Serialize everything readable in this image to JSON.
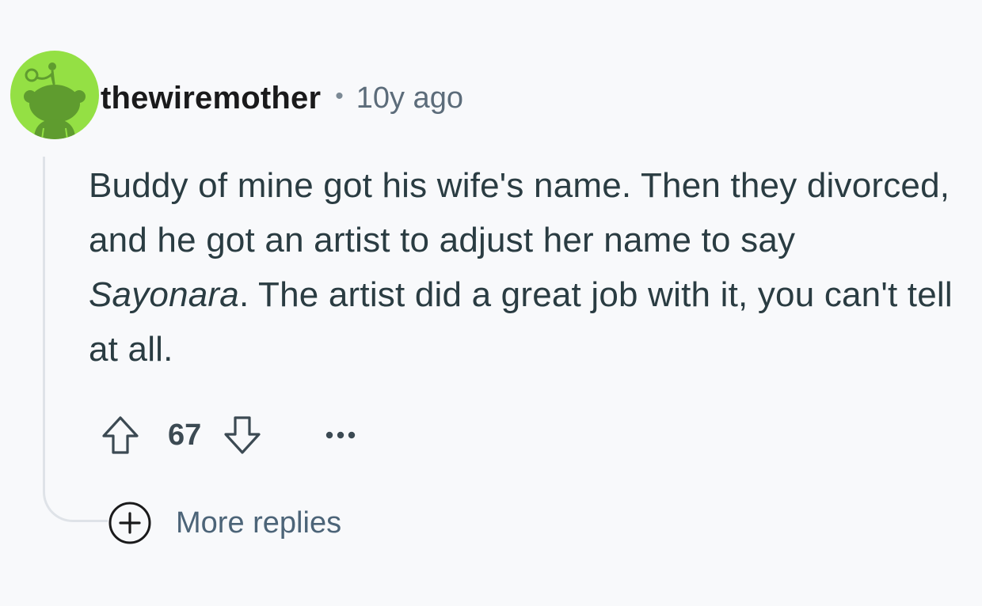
{
  "comment": {
    "username": "thewiremother",
    "separator": "•",
    "timestamp": "10y ago",
    "body": {
      "part1": "Buddy of mine got his wife's name. Then they divorced, and he got an artist to adjust her name to say ",
      "emphasis": "Sayonara",
      "part2": ". The artist did a great job with it, you can't tell at all."
    },
    "score": "67",
    "more_replies_label": "More replies"
  },
  "icons": {
    "avatar": "snoo-avatar-icon",
    "upvote": "arrow-up-icon",
    "downvote": "arrow-down-icon",
    "overflow": "ellipsis-icon",
    "expand": "plus-circle-icon"
  },
  "colors": {
    "avatar_bg": "#94e044",
    "avatar_figure": "#5f9c2f",
    "background": "#f8f9fb",
    "thread_line": "#dfe3e8"
  }
}
